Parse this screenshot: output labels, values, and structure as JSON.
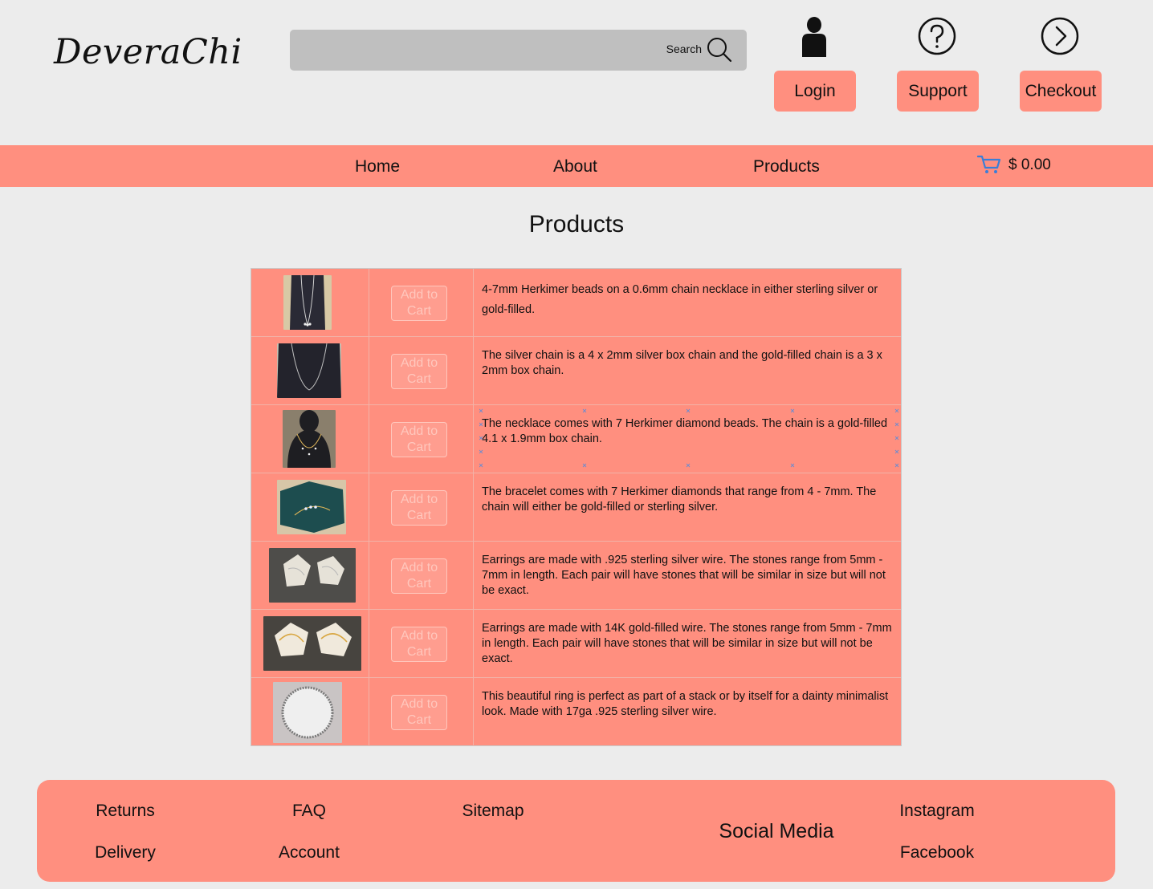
{
  "header": {
    "logo": "DeveraChi",
    "search": {
      "label": "Search"
    },
    "buttons": {
      "login": "Login",
      "support": "Support",
      "checkout": "Checkout"
    }
  },
  "nav": {
    "items": [
      "Home",
      "About",
      "Products"
    ],
    "cart_total": "$ 0.00"
  },
  "page_title": "Products",
  "products": [
    {
      "image": "herkimer-necklace-on-stand-photo",
      "button": "Add to\nCart",
      "description": "4-7mm Herkimer beads on a 0.6mm chain necklace in either sterling silver or gold-filled."
    },
    {
      "image": "silver-box-chain-necklace-photo",
      "button": "Add to\nCart",
      "description": "The silver chain is a 4 x 2mm silver box chain and the gold-filled chain is a 3 x 2mm box chain."
    },
    {
      "image": "gold-chain-necklace-on-bust-photo",
      "button": "Add to\nCart",
      "description": "The necklace comes with 7 Herkimer diamond beads. The chain is a gold-filled 4.1 x 1.9mm box chain."
    },
    {
      "image": "bracelet-on-green-stone-photo",
      "button": "Add to\nCart",
      "description": "The bracelet comes with 7 Herkimer diamonds that range from 4 - 7mm. The chain will either be gold-filled or sterling silver."
    },
    {
      "image": "silver-wire-earrings-photo",
      "button": "Add to\nCart",
      "description": "Earrings are made with .925 sterling silver wire. The stones range from 5mm - 7mm in length. Each pair will have stones that will be similar in size but will not be exact."
    },
    {
      "image": "gold-wire-earrings-photo",
      "button": "Add to\nCart",
      "description": "Earrings are made with 14K gold-filled wire. The stones range from 5mm - 7mm in length. Each pair will have stones that will be similar in size but will not be exact."
    },
    {
      "image": "silver-beaded-ring-photo",
      "button": "Add to\nCart",
      "description": "This beautiful ring is perfect as part of a stack or by itself for a dainty minimalist look. Made with 17ga .925 sterling silver wire."
    }
  ],
  "footer": {
    "links": [
      "Returns",
      "FAQ",
      "Sitemap",
      "Delivery",
      "Account"
    ],
    "social_heading": "Social Media",
    "social_links": [
      "Instagram",
      "Facebook"
    ]
  },
  "colors": {
    "accent": "#ff8f7f",
    "background": "#ececec",
    "search_bg": "#bfbfbf",
    "button_text_faded": "#ffc7bd"
  }
}
